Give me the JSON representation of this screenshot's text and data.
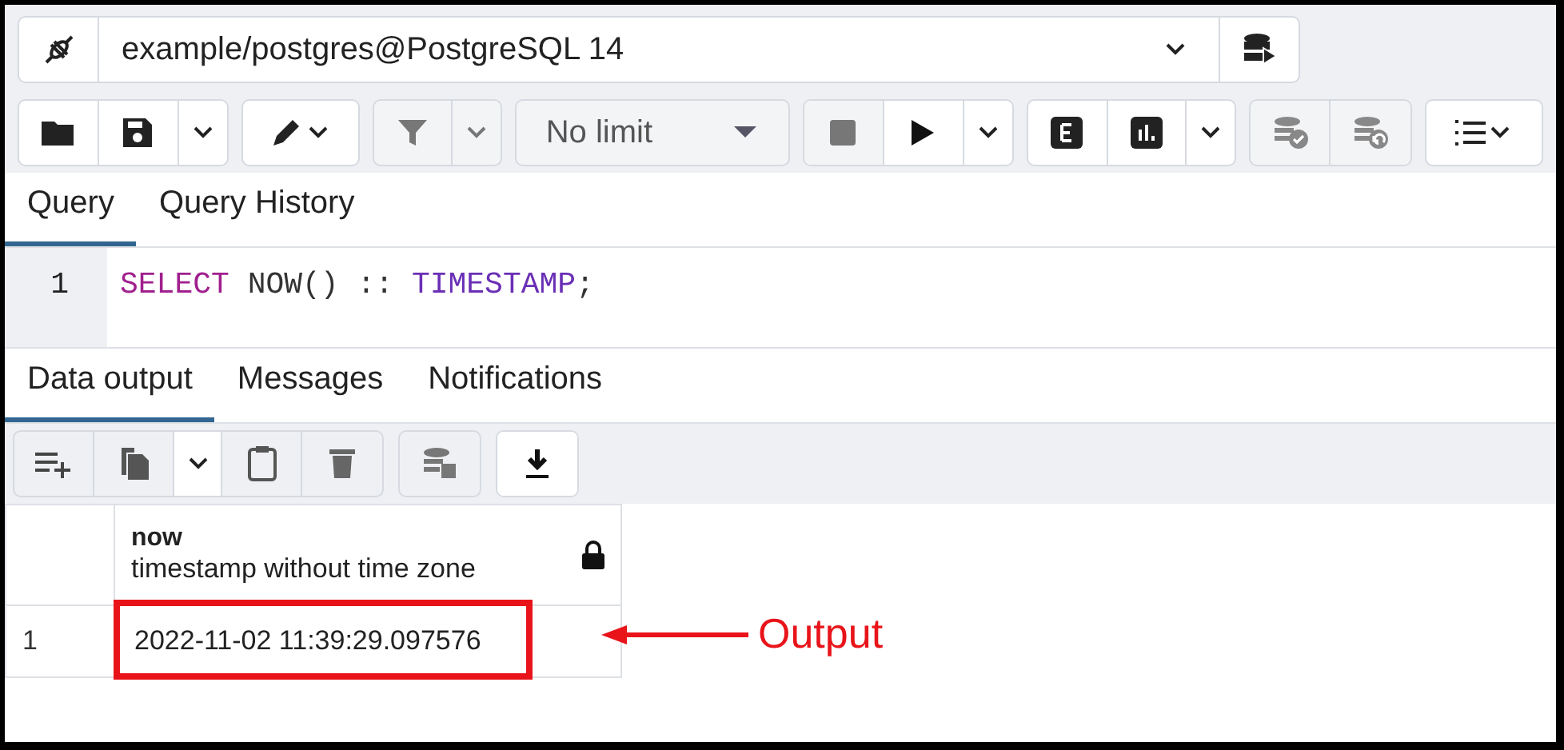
{
  "connection": {
    "label": "example/postgres@PostgreSQL 14"
  },
  "row_limit": {
    "value": "No limit"
  },
  "query_tabs": [
    {
      "label": "Query",
      "selected": true
    },
    {
      "label": "Query History",
      "selected": false
    }
  ],
  "editor": {
    "lines": [
      {
        "number": "1",
        "tokens": [
          {
            "text": "SELECT",
            "kind": "keyword"
          },
          {
            "text": " NOW() :: ",
            "kind": "plain"
          },
          {
            "text": "TIMESTAMP",
            "kind": "type"
          },
          {
            "text": ";",
            "kind": "plain"
          }
        ]
      }
    ]
  },
  "output_tabs": [
    {
      "label": "Data output",
      "selected": true
    },
    {
      "label": "Messages",
      "selected": false
    },
    {
      "label": "Notifications",
      "selected": false
    }
  ],
  "grid": {
    "columns": [
      {
        "name": "now",
        "type": "timestamp without time zone",
        "locked": true
      }
    ],
    "rows": [
      {
        "number": "1",
        "cells": [
          "2022-11-02 11:39:29.097576"
        ]
      }
    ]
  },
  "annotation": {
    "label": "Output"
  }
}
